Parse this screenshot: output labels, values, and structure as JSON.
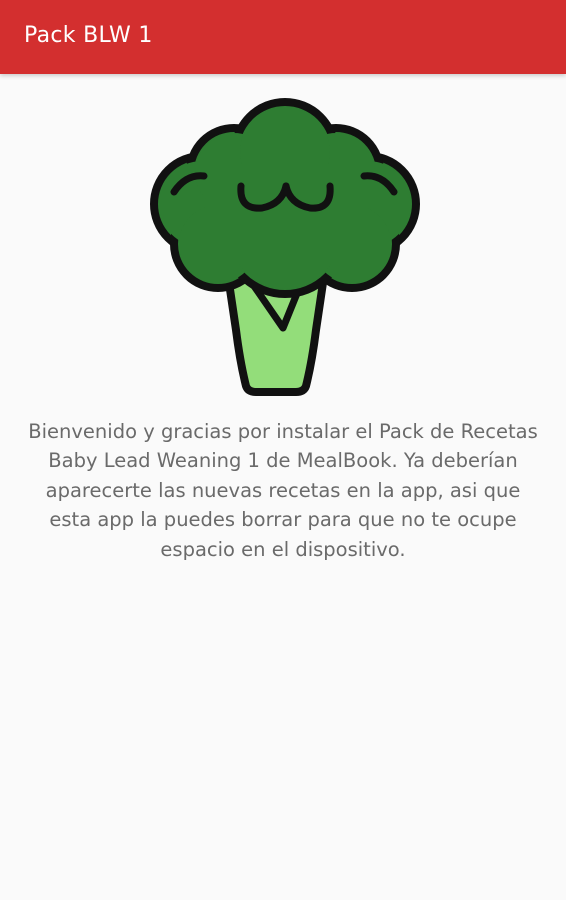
{
  "app_bar": {
    "title": "Pack BLW 1",
    "color": "#d32f2f"
  },
  "illustration": {
    "icon": "broccoli-icon",
    "colors": {
      "florets": "#2e7d32",
      "stem": "#93dd7a",
      "outline": "#111111"
    }
  },
  "message": {
    "text": "Bienvenido y gracias por instalar el Pack de Recetas Baby Lead Weaning 1 de MealBook. Ya deberían aparecerte las nuevas recetas en la app, asi que esta app la puedes borrar para que no te ocupe espacio en el dispositivo."
  }
}
